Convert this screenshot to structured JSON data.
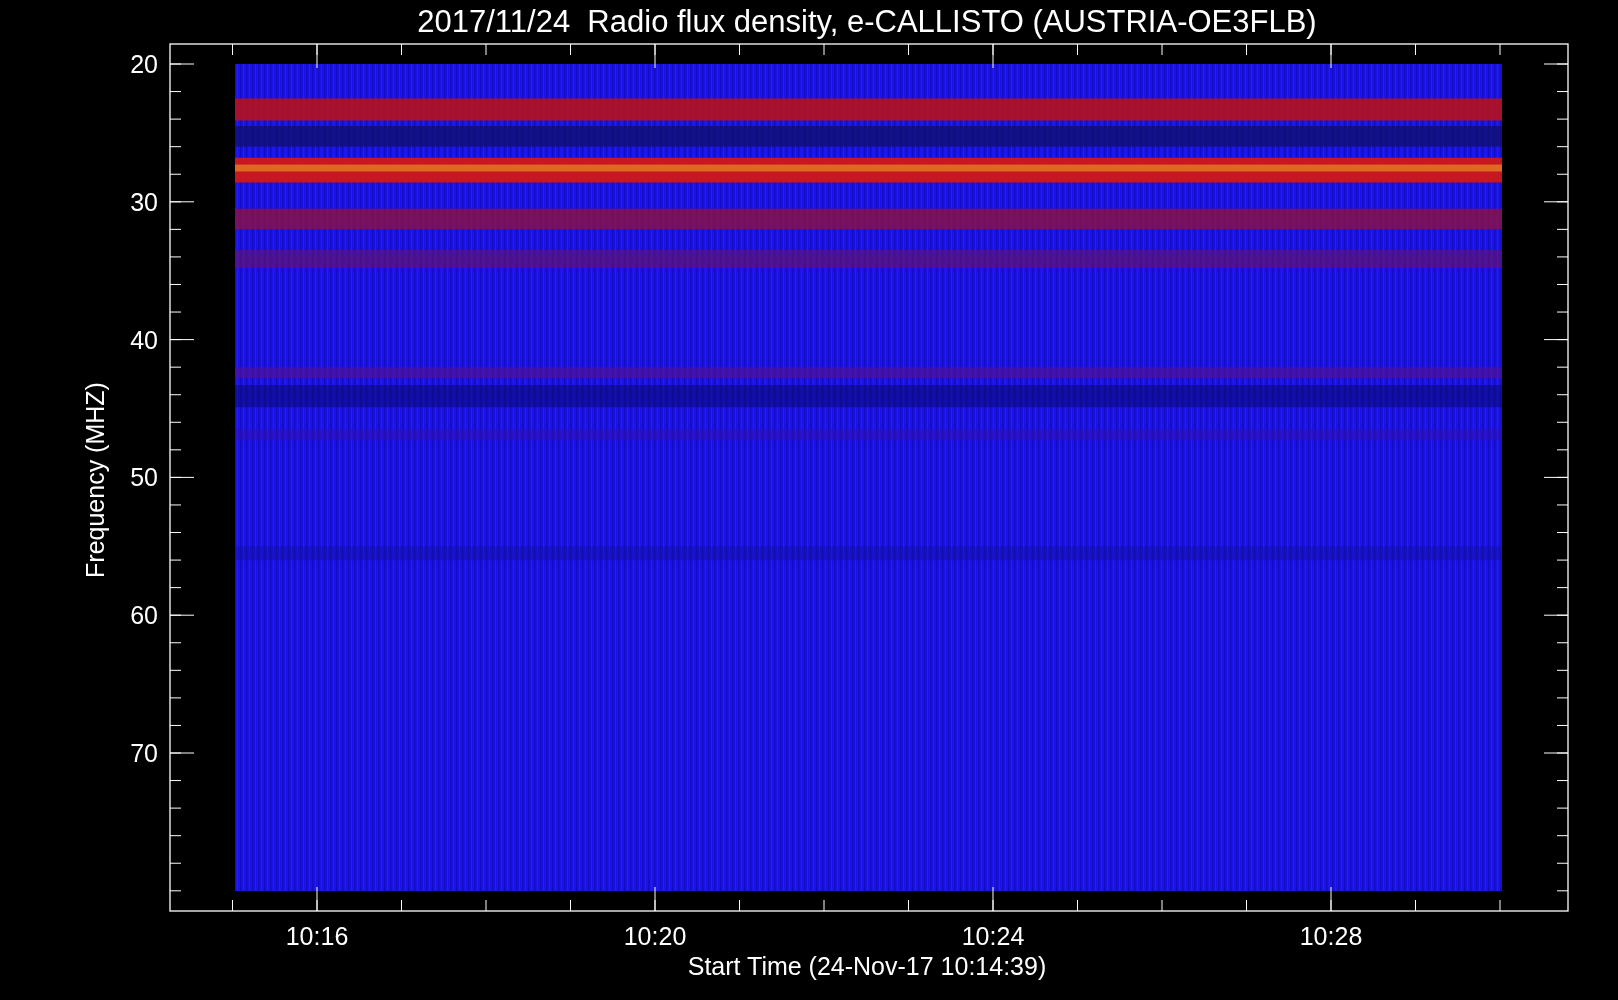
{
  "title": "2017/11/24  Radio flux density, e-CALLISTO (AUSTRIA-OE3FLB)",
  "y_axis": {
    "label": "Frequency (MHZ)",
    "ticks": [
      "20",
      "30",
      "40",
      "50",
      "60",
      "70"
    ]
  },
  "x_axis": {
    "label": "Start Time (24-Nov-17 10:14:39)",
    "ticks": [
      "10:16",
      "10:20",
      "10:24",
      "10:28"
    ]
  }
}
